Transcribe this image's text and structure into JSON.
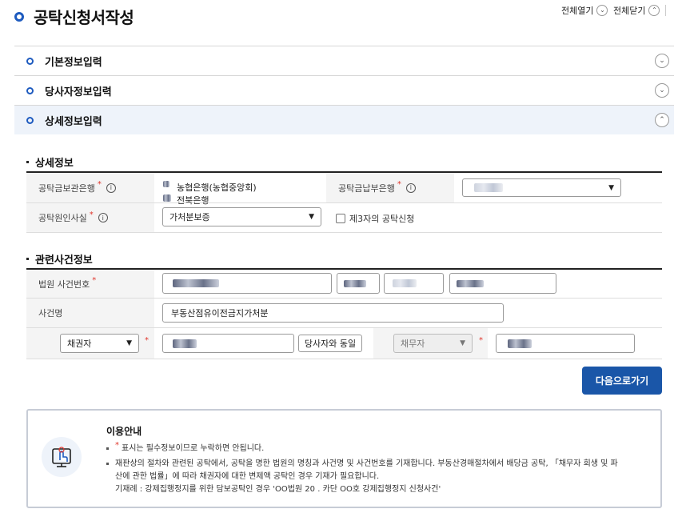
{
  "header": {
    "title": "공탁신청서작성",
    "expand_all": "전체열기",
    "collapse_all": "전체닫기"
  },
  "accordion": [
    {
      "label": "기본정보입력",
      "state": "collapsed"
    },
    {
      "label": "당사자정보입력",
      "state": "collapsed"
    },
    {
      "label": "상세정보입력",
      "state": "expanded"
    }
  ],
  "detail": {
    "section_title": "상세정보",
    "deposit_office_label": "공탁금보관은행",
    "deposit_bank_lines": [
      "농협은행(농협중앙회)",
      "전북은행"
    ],
    "payment_bank_label": "공탁금납부은행",
    "cause_label": "공탁원인사실",
    "cause_value": "가처분보증",
    "third_party_label": "제3자의 공탁신청"
  },
  "case": {
    "section_title": "관련사건정보",
    "case_number_label": "법원 사건번호",
    "case_name_label": "사건명",
    "case_name_value": "부동산점유이전금지가처분",
    "creditor_select": "채권자",
    "same_as_party_button": "당사자와 동일",
    "debtor_select": "채무자"
  },
  "actions": {
    "next_button": "다음으로가기"
  },
  "guide": {
    "title": "이용안내",
    "items": [
      "표시는 필수정보이므로 누락하면 안됩니다.",
      "재판상의 절차와 관련된 공탁에서, 공탁을 명한 법원의 명칭과 사건명 및 사건번호를 기재합니다. 부동산경매절차에서 배당금 공탁, 「채무자 회생 및 파",
      "산에 관한 법률」에 따라 채권자에 대한 변제액 공탁인 경우 기재가 필요합니다.",
      "기재례 : 강제집행정지를 위한 담보공탁인 경우 'OO법원 20 . 카단 OO호 강제집행정지 신청사건'"
    ],
    "required_mark": "*"
  },
  "colors": {
    "accent": "#1e5bbf",
    "primary_button": "#1a56a8",
    "required": "#e0352b"
  }
}
